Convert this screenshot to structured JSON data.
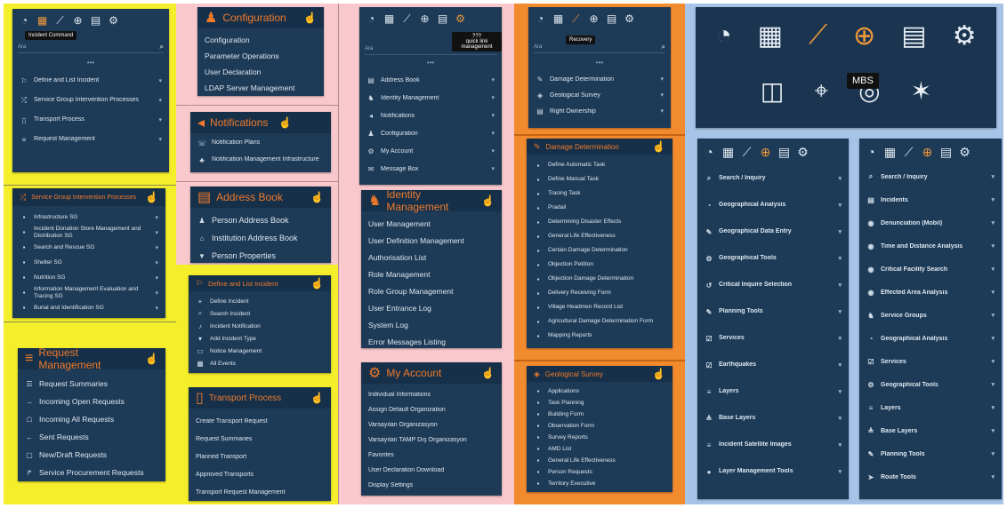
{
  "colors": {
    "yellow": "#f5ee2a",
    "pink": "#f9c8cc",
    "orange": "#f28a2e",
    "blue": "#a7c3e6",
    "panel": "#1d3a57",
    "accent": "#f07a2a"
  },
  "col1": {
    "top": {
      "tooltip": "Incident Command",
      "search_placeholder": "Ara",
      "items": [
        {
          "icon": "flag-icon",
          "glyph": "⚐",
          "label": "Define and List Incident"
        },
        {
          "icon": "shuffle-icon",
          "glyph": "⤮",
          "label": "Service Group Intervention Processes"
        },
        {
          "icon": "tablet-icon",
          "glyph": "▯",
          "label": "Transport Process"
        },
        {
          "icon": "database-icon",
          "glyph": "≡",
          "label": "Request Management"
        }
      ]
    },
    "sgi": {
      "title": "Service Group Intervention Processes",
      "items": [
        {
          "label": "Infrastructure SG"
        },
        {
          "label": "Incident Donation Store Management and Distribution SG"
        },
        {
          "label": "Search and Rescue SG"
        },
        {
          "label": "Shelter SG"
        },
        {
          "label": "Nutrition SG"
        },
        {
          "label": "Information Management Evaluation and Tracing SG"
        },
        {
          "label": "Burial and Identification SG"
        }
      ]
    },
    "request": {
      "title": "Request Management",
      "items": [
        {
          "glyph": "☰",
          "label": "Request Summaries"
        },
        {
          "glyph": "→",
          "label": "Incoming Open Requests"
        },
        {
          "glyph": "☖",
          "label": "Incoming All Requests"
        },
        {
          "glyph": "←",
          "label": "Sent Requests"
        },
        {
          "glyph": "▢",
          "label": "New/Draft Requests"
        },
        {
          "glyph": "↱",
          "label": "Service Procurement Requests"
        }
      ]
    }
  },
  "col2": {
    "config": {
      "title": "Configuration",
      "items": [
        "Configuration",
        "Parameter Operations",
        "User Declaration",
        "LDAP Server Management"
      ]
    },
    "notifications": {
      "title": "Notifications",
      "items": [
        {
          "glyph": "☏",
          "label": "Notification Plans"
        },
        {
          "glyph": "♣",
          "label": "Notification Management Infrastructure"
        }
      ]
    },
    "address": {
      "title": "Address Book",
      "items": [
        {
          "glyph": "♟",
          "label": "Person Address Book"
        },
        {
          "glyph": "⌂",
          "label": "Institution Address Book"
        },
        {
          "glyph": "▼",
          "label": "Person Properties"
        }
      ]
    },
    "define": {
      "title": "Define and List Incident",
      "items": [
        {
          "glyph": "+",
          "label": "Define Incident"
        },
        {
          "glyph": "⌕",
          "label": "Search Incident"
        },
        {
          "glyph": "♪",
          "label": "Incident Notification"
        },
        {
          "glyph": "▾",
          "label": "Add Incident Type"
        },
        {
          "glyph": "▭",
          "label": "Notice Management"
        },
        {
          "glyph": "▦",
          "label": "All Events"
        }
      ]
    },
    "transport": {
      "title": "Transport Process",
      "items": [
        "Create Transport Request",
        "Request Summaries",
        "Planned Transport",
        "Approved Transports",
        "Transport Request Management"
      ]
    }
  },
  "col3": {
    "top": {
      "tooltip": "quick link management",
      "tooltip_head": "???",
      "search_placeholder": "Ara",
      "items": [
        {
          "glyph": "▤",
          "label": "Address Book"
        },
        {
          "glyph": "♞",
          "label": "Identity Management"
        },
        {
          "glyph": "◂",
          "label": "Notifications"
        },
        {
          "glyph": "♟",
          "label": "Configuration"
        },
        {
          "glyph": "⚙",
          "label": "My Account"
        },
        {
          "glyph": "✉",
          "label": "Message Box"
        }
      ]
    },
    "identity": {
      "title": "Identity Management",
      "items": [
        "User Management",
        "User Definition Management",
        "Authorisation List",
        "Role Management",
        "Role Group Management",
        "User Entrance Log",
        "System Log",
        "Error Messages Listing"
      ]
    },
    "account": {
      "title": "My Account",
      "items": [
        "Individual Informations",
        "Assign Default Organization",
        "Varsayılan Organizasyon",
        "Varsayılan TAMP Dış Organizasyon",
        "Favorites",
        "User Declaration Download",
        "Display Settings"
      ]
    }
  },
  "col4": {
    "top": {
      "tooltip": "Recovery",
      "search_placeholder": "Ara",
      "items": [
        {
          "glyph": "✎",
          "label": "Damage Determination"
        },
        {
          "glyph": "◈",
          "label": "Geological Survey"
        },
        {
          "glyph": "▤",
          "label": "Right Ownership"
        }
      ]
    },
    "damage": {
      "title": "Damage Determination",
      "items": [
        "Define Automatic Task",
        "Define Manual Task",
        "Tracing Task",
        "Pradail",
        "Determining Disaster Effects",
        "General Life Effectiveness",
        "Certain Damage Determination",
        "Objection Petition",
        "Objection Damage Determination",
        "Delivery Receiving Form",
        "Village Headmen Record List",
        "Agricultural Damage Determination Form",
        "Mapping Reports"
      ]
    },
    "geo": {
      "title": "Geological Survey",
      "items": [
        "Applications",
        "Task Planning",
        "Building Form",
        "Observation Form",
        "Survey Reports",
        "AMD List",
        "General Life Effectiveness",
        "Person Requests",
        "Territory Executive"
      ]
    }
  },
  "col5": {
    "big": {
      "tooltip": "MBS",
      "icons_row1": [
        "satellite-dish-icon",
        "calendar-icon",
        "chart-trend-icon",
        "globe-icon",
        "document-icon",
        "gear-icon"
      ],
      "icons_row2": [
        "map-icon",
        "route-icon",
        "radar-icon",
        "network-icon"
      ]
    },
    "left": {
      "items": [
        {
          "glyph": "⌕",
          "label": "Search / Inquiry"
        },
        {
          "glyph": "◔",
          "label": "Geographical Analysis"
        },
        {
          "glyph": "✎",
          "label": "Geographical Data Entry"
        },
        {
          "glyph": "⚙",
          "label": "Geographical Tools"
        },
        {
          "glyph": "↺",
          "label": "Critical Inquire Selection"
        },
        {
          "glyph": "✎",
          "label": "Planning Tools"
        },
        {
          "glyph": "☑",
          "label": "Services"
        },
        {
          "glyph": "☑",
          "label": "Earthquakes"
        },
        {
          "glyph": "≡",
          "label": "Layers"
        },
        {
          "glyph": "≜",
          "label": "Base Layers"
        },
        {
          "glyph": "≡",
          "label": "Incident Satellite Images"
        },
        {
          "glyph": "●",
          "label": "Layer Management Tools"
        }
      ]
    },
    "right": {
      "items": [
        {
          "glyph": "⌕",
          "label": "Search / Inquiry"
        },
        {
          "glyph": "▤",
          "label": "Incidents"
        },
        {
          "glyph": "◉",
          "label": "Denunciation (Mobil)"
        },
        {
          "glyph": "◉",
          "label": "Time and Distance Analysis"
        },
        {
          "glyph": "◉",
          "label": "Critical Facility Search"
        },
        {
          "glyph": "◉",
          "label": "Effected Area Analysis"
        },
        {
          "glyph": "♞",
          "label": "Service Groups"
        },
        {
          "glyph": "◔",
          "label": "Geographical Analysis"
        },
        {
          "glyph": "☑",
          "label": "Services"
        },
        {
          "glyph": "⚙",
          "label": "Geographical Tools"
        },
        {
          "glyph": "≡",
          "label": "Layers"
        },
        {
          "glyph": "≜",
          "label": "Base Layers"
        },
        {
          "glyph": "✎",
          "label": "Planning Tools"
        },
        {
          "glyph": "➤",
          "label": "Route Tools"
        }
      ]
    }
  }
}
